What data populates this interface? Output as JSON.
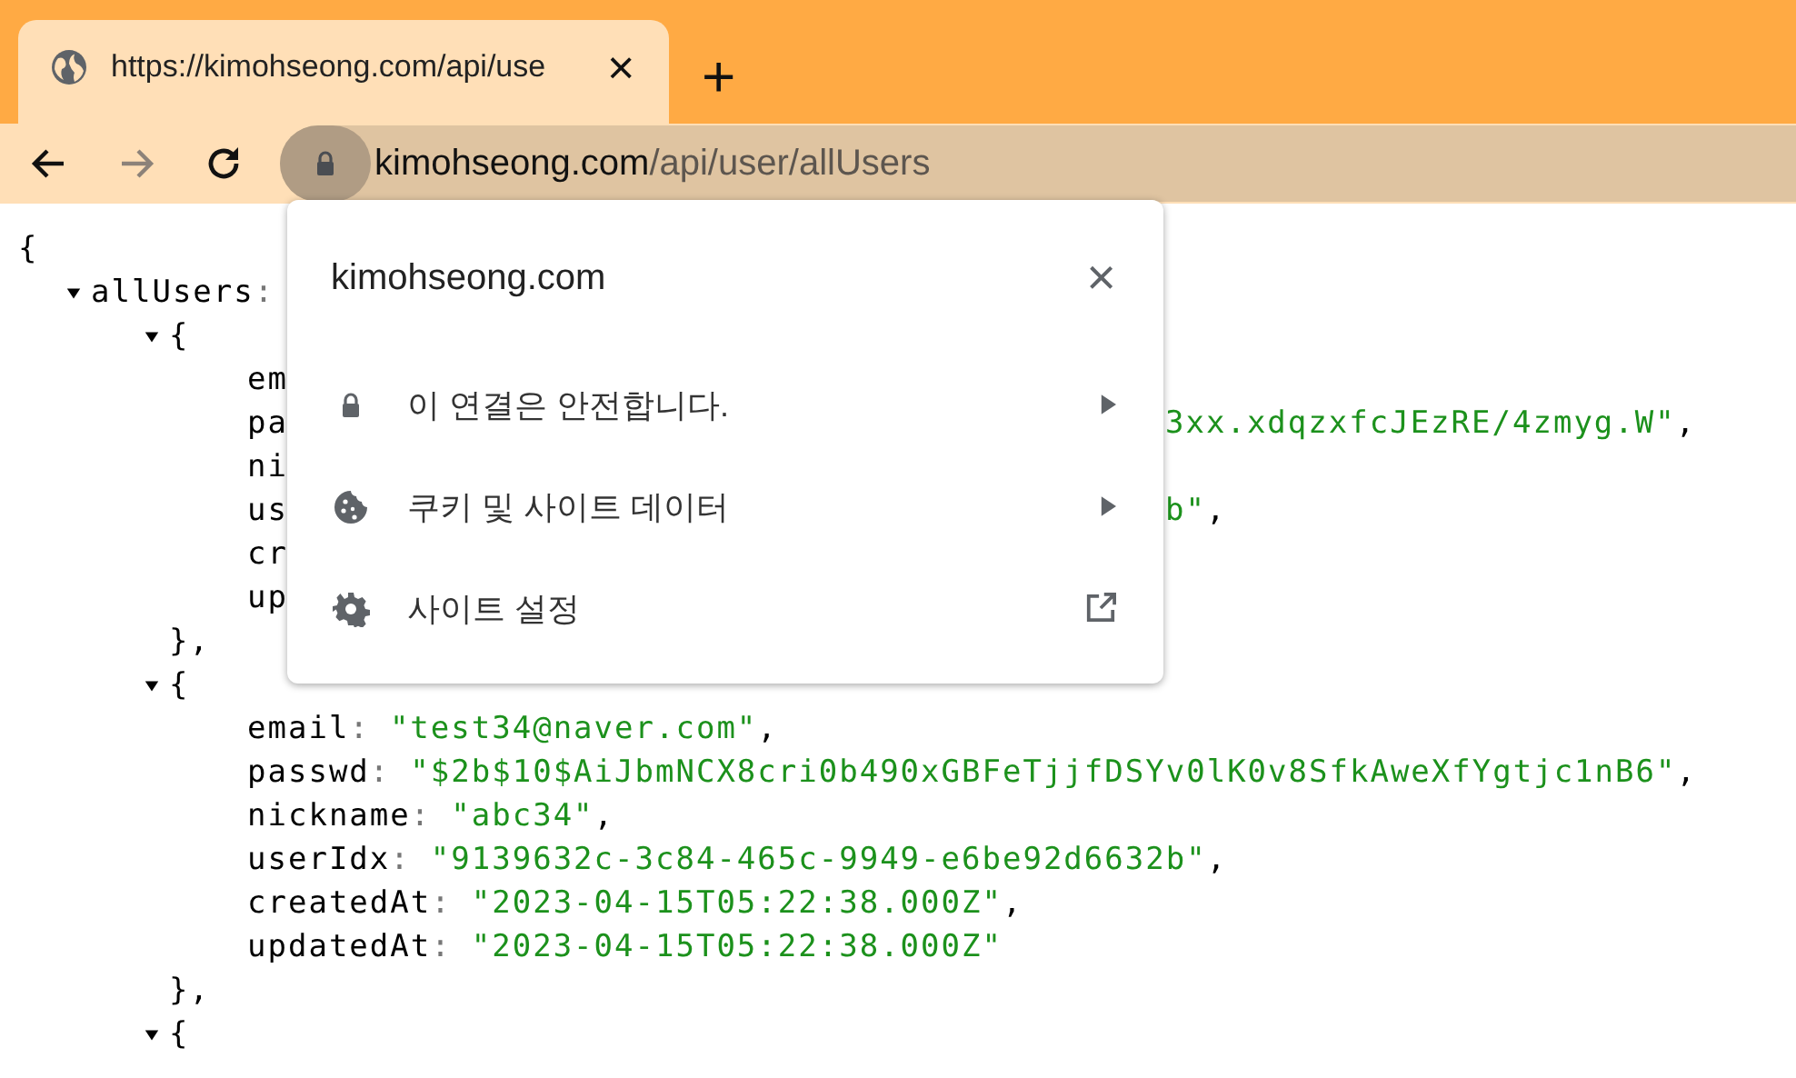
{
  "tab": {
    "title": "https://kimohseong.com/api/use",
    "close": "×"
  },
  "new_tab": "+",
  "back_button": {
    "disabled": false
  },
  "forward_button": {
    "disabled": true
  },
  "address_bar": {
    "domain": "kimohseong.com",
    "path": "/api/user/allUsers"
  },
  "json_view": {
    "open": "{",
    "arrays": [
      {
        "key": "allUsers",
        "colon": ":",
        "expanded": true,
        "items": [
          {
            "expanded": true,
            "open": "{",
            "close": "},",
            "fields": [
              {
                "key": "em"
              },
              {
                "key": "pa",
                "tail": "3xx.xdqzxfcJEzRE/4zmyg.W\"",
                "comma": ","
              },
              {
                "key": "ni"
              },
              {
                "key": "us",
                "tail": "b\"",
                "comma": ","
              },
              {
                "key": "cr"
              },
              {
                "key": "up"
              }
            ]
          },
          {
            "expanded": true,
            "open": "{",
            "close": "},",
            "fields": [
              {
                "key": "email",
                "colon": ":",
                "value": "\"test34@naver.com\"",
                "comma": ","
              },
              {
                "key": "passwd",
                "colon": ":",
                "value": "\"$2b$10$AiJbmNCX8cri0b490xGBFeTjjfDSYv0lK0v8SfkAweXfYgtjc1nB6\"",
                "comma": ","
              },
              {
                "key": "nickname",
                "colon": ":",
                "value": "\"abc34\"",
                "comma": ","
              },
              {
                "key": "userIdx",
                "colon": ":",
                "value": "\"9139632c-3c84-465c-9949-e6be92d6632b\"",
                "comma": ","
              },
              {
                "key": "createdAt",
                "colon": ":",
                "value": "\"2023-04-15T05:22:38.000Z\"",
                "comma": ","
              },
              {
                "key": "updatedAt",
                "colon": ":",
                "value": "\"2023-04-15T05:22:38.000Z\""
              }
            ]
          },
          {
            "expanded": true,
            "open": "{"
          }
        ]
      }
    ]
  },
  "site_info_popup": {
    "title": "kimohseong.com",
    "close": "×",
    "items": [
      {
        "kind": "connection",
        "label": "이 연결은 안전합니다."
      },
      {
        "kind": "cookies",
        "label": "쿠키 및 사이트 데이터"
      },
      {
        "kind": "settings",
        "label": "사이트 설정"
      }
    ]
  }
}
